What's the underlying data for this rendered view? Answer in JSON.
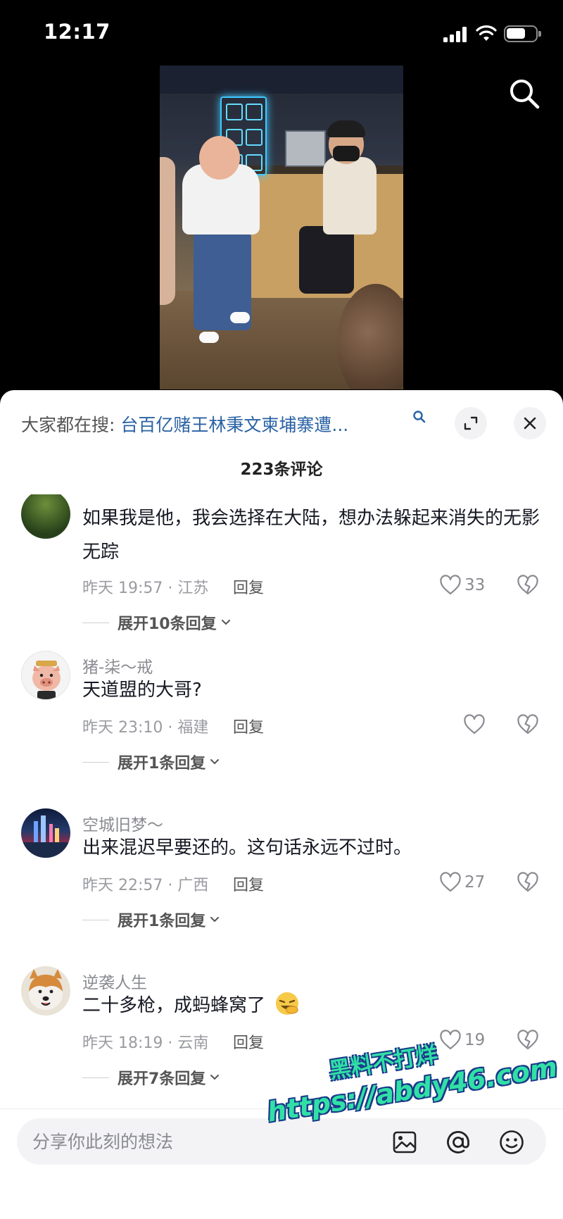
{
  "status_bar": {
    "time": "12:17"
  },
  "sheet": {
    "search_prefix": "大家都在搜:",
    "search_query": "台百亿赌王林秉文柬埔寨遭...",
    "comment_count": "223条评论"
  },
  "comments": [
    {
      "user": "",
      "text": "如果我是他，我会选择在大陆，想办法躲起来消失的无影无踪",
      "meta": "昨天 19:57 · 江苏",
      "reply": "回复",
      "likes": "33",
      "more": "展开10条回复"
    },
    {
      "user": "猪-柒～戒",
      "text": "天道盟的大哥?",
      "meta": "昨天 23:10 · 福建",
      "reply": "回复",
      "likes": "",
      "more": "展开1条回复"
    },
    {
      "user": "空城旧梦～",
      "text": "出来混迟早要还的。这句话永远不过时。",
      "meta": "昨天 22:57 · 广西",
      "reply": "回复",
      "likes": "27",
      "more": "展开1条回复"
    },
    {
      "user": "逆袭人生",
      "text": "二十多枪，成蚂蜂窝了",
      "meta": "昨天 18:19 · 云南",
      "reply": "回复",
      "likes": "19",
      "more": "展开7条回复"
    }
  ],
  "input": {
    "placeholder": "分享你此刻的想法"
  },
  "watermark": {
    "line1": "黑料不打烊",
    "line2": "https://abdy46.com"
  },
  "icons": {
    "search": "search-icon",
    "expand": "expand-icon",
    "close": "close-icon",
    "like": "heart-icon",
    "dislike": "broken-heart-icon",
    "image": "image-icon",
    "mention": "at-icon",
    "emoji": "emoji-icon",
    "sticker": "laughing-emoji-icon"
  },
  "colors": {
    "search_query": "#2a62a4",
    "watermark_fill": "#30e0a6",
    "watermark_outline": "#1a3b8a"
  }
}
